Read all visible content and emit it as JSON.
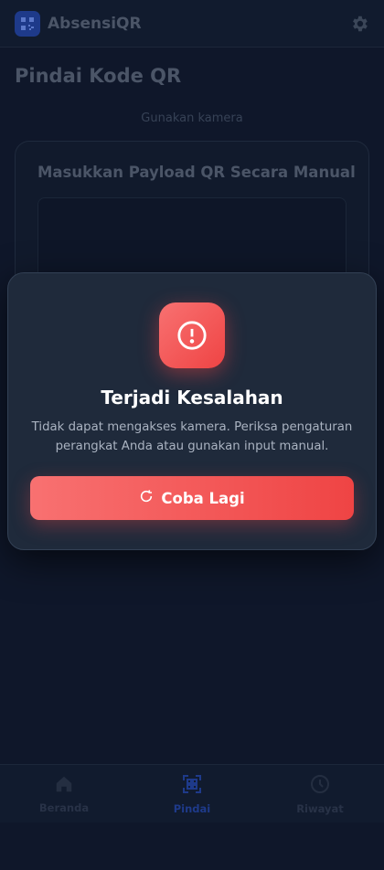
{
  "header": {
    "app_name": "AbsensiQR",
    "logo_icon": "qr-code-icon",
    "settings_icon": "gear-icon"
  },
  "page": {
    "title": "Pindai Kode QR",
    "camera_hint": "Gunakan kamera",
    "manual_title": "Masukkan Payload QR Secara Manual"
  },
  "modal": {
    "icon": "alert-circle-icon",
    "title": "Terjadi Kesalahan",
    "message": "Tidak dapat mengakses kamera. Periksa pengaturan perangkat Anda atau gunakan input manual.",
    "button_label": "Coba Lagi",
    "button_icon": "refresh-icon",
    "accent_color": "#ef4444"
  },
  "nav": {
    "items": [
      {
        "label": "Beranda",
        "icon": "home-icon",
        "active": false
      },
      {
        "label": "Pindai",
        "icon": "qr-scan-icon",
        "active": true
      },
      {
        "label": "Riwayat",
        "icon": "clock-icon",
        "active": false
      }
    ]
  }
}
